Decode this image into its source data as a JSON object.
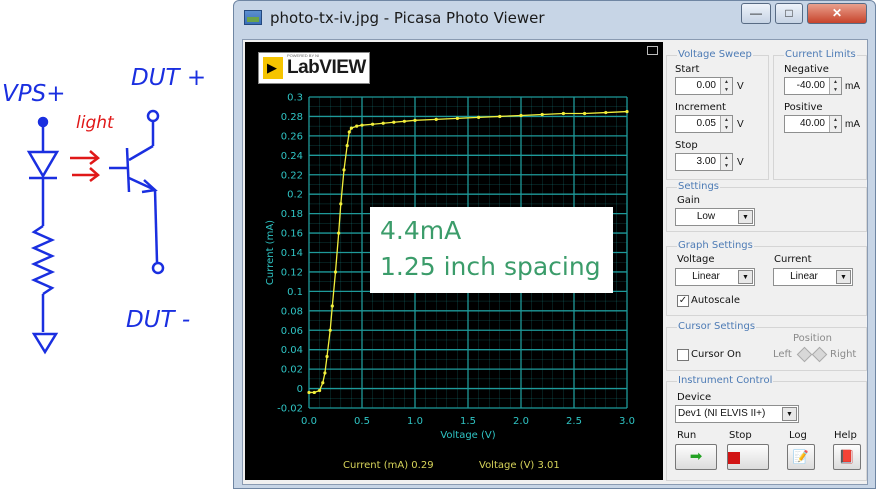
{
  "sketch": {
    "vps_label": "VPS+",
    "light_label": "light",
    "dut_plus_label": "DUT +",
    "dut_minus_label": "DUT -"
  },
  "window": {
    "title": "photo-tx-iv.jpg - Picasa Photo Viewer",
    "min_glyph": "—",
    "max_glyph": "□",
    "close_glyph": "✕"
  },
  "graph": {
    "logo_text": "LabVIEW",
    "logo_powered": "POWERED BY NI",
    "xlabel": "Voltage (V)",
    "ylabel": "Current (mA)",
    "x_ticks": [
      "0.0",
      "0.5",
      "1.0",
      "1.5",
      "2.0",
      "2.5",
      "3.0"
    ],
    "y_ticks": [
      "0.3",
      "0.28",
      "0.26",
      "0.24",
      "0.22",
      "0.2",
      "0.18",
      "0.16",
      "0.14",
      "0.12",
      "0.1",
      "0.08",
      "0.06",
      "0.04",
      "0.02",
      "0",
      "-0.02"
    ],
    "readout_current": "Current (mA)  0.29",
    "readout_voltage": "Voltage (V)  3.01",
    "annotation": {
      "line1": "4.4mA",
      "line2": "1.25 inch spacing"
    }
  },
  "chart_data": {
    "type": "line",
    "xlabel": "Voltage (V)",
    "ylabel": "Current (mA)",
    "xlim": [
      0,
      3
    ],
    "ylim": [
      -0.02,
      0.3
    ],
    "grid": true,
    "series": [
      {
        "x": [
          0.0,
          0.05,
          0.1,
          0.13,
          0.15,
          0.17,
          0.2,
          0.22,
          0.25,
          0.28,
          0.3,
          0.33,
          0.36,
          0.38,
          0.4,
          0.45,
          0.5,
          0.6,
          0.7,
          0.8,
          0.9,
          1.0,
          1.2,
          1.4,
          1.6,
          1.8,
          2.0,
          2.2,
          2.4,
          2.6,
          2.8,
          3.0
        ],
        "y": [
          -0.004,
          -0.004,
          -0.002,
          0.006,
          0.016,
          0.033,
          0.06,
          0.085,
          0.12,
          0.16,
          0.19,
          0.225,
          0.25,
          0.264,
          0.268,
          0.27,
          0.271,
          0.272,
          0.273,
          0.274,
          0.275,
          0.276,
          0.277,
          0.278,
          0.279,
          0.28,
          0.281,
          0.282,
          0.283,
          0.283,
          0.284,
          0.285
        ]
      }
    ]
  },
  "controls": {
    "voltage_sweep": {
      "title": "Voltage Sweep",
      "start_label": "Start",
      "start_value": "0.00",
      "increment_label": "Increment",
      "increment_value": "0.05",
      "stop_label": "Stop",
      "stop_value": "3.00",
      "unit": "V"
    },
    "current_limits": {
      "title": "Current Limits",
      "negative_label": "Negative",
      "negative_value": "-40.00",
      "positive_label": "Positive",
      "positive_value": "40.00",
      "unit": "mA"
    },
    "settings": {
      "title": "Settings",
      "gain_label": "Gain",
      "gain_value": "Low"
    },
    "graph_settings": {
      "title": "Graph Settings",
      "voltage_label": "Voltage",
      "voltage_value": "Linear",
      "current_label": "Current",
      "current_value": "Linear",
      "autoscale_label": "Autoscale",
      "autoscale_checked": true
    },
    "cursor_settings": {
      "title": "Cursor Settings",
      "cursor_on_label": "Cursor On",
      "cursor_on_checked": false,
      "position_label": "Position",
      "left_label": "Left",
      "right_label": "Right"
    },
    "instrument_control": {
      "title": "Instrument Control",
      "device_label": "Device",
      "device_value": "Dev1 (NI ELVIS II+)",
      "run_label": "Run",
      "stop_label": "Stop",
      "log_label": "Log",
      "help_label": "Help"
    }
  },
  "colors": {
    "plot_bg": "#000000",
    "grid": "#1e9a9a",
    "trace": "#f2ef3c",
    "axis_text": "#2fc4c4",
    "annotation_text": "#3b9c6a",
    "group_title": "#4d7bb5",
    "ink_blue": "#1a2fe0",
    "ink_red": "#e01818"
  }
}
